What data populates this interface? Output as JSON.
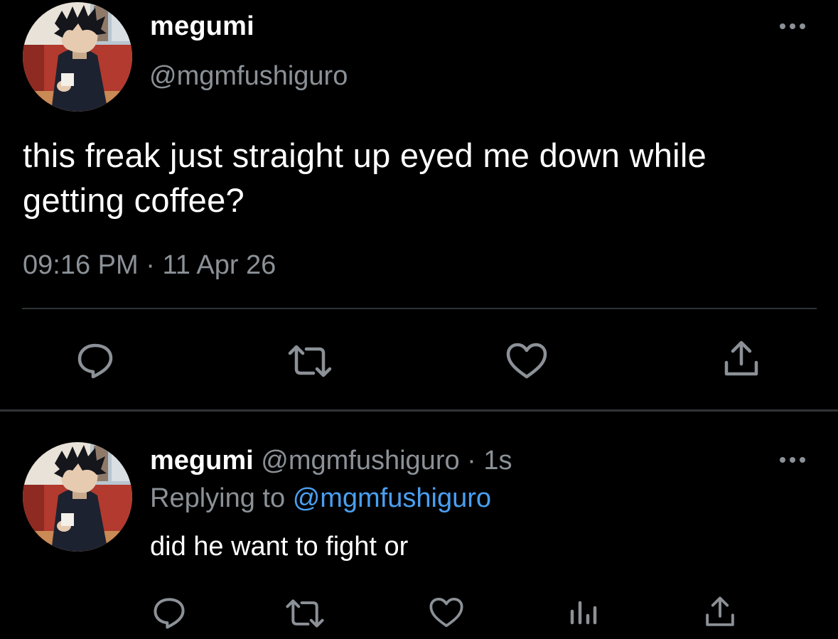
{
  "colors": {
    "background": "#000000",
    "text_primary": "#ffffff",
    "text_secondary": "#8b9197",
    "link": "#4a9ff0",
    "divider": "#2f3336"
  },
  "main_tweet": {
    "display_name": "megumi",
    "handle": "@mgmfushiguro",
    "text": "this freak just straight up eyed me down while getting coffee?",
    "time": "09:16 PM",
    "separator": " · ",
    "date": "11 Apr 26",
    "more_icon": "more-horizontal-icon",
    "actions": [
      "reply-icon",
      "retweet-icon",
      "like-icon",
      "share-icon"
    ]
  },
  "reply_tweet": {
    "display_name": "megumi",
    "handle": "@mgmfushiguro",
    "separator": " · ",
    "time_ago": "1s",
    "replying_to_label": "Replying to",
    "replying_to_handle": "@mgmfushiguro",
    "text": "did he want to fight or",
    "more_icon": "more-horizontal-icon",
    "actions": [
      "reply-icon",
      "retweet-icon",
      "like-icon",
      "analytics-icon",
      "share-icon"
    ]
  }
}
